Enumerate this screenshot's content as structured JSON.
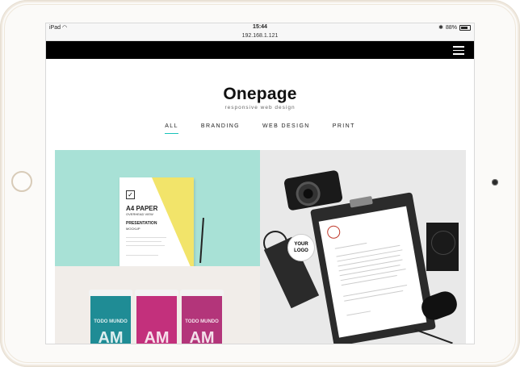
{
  "device": {
    "status_left": "iPad",
    "wifi_glyph": "◠",
    "time": "15:44",
    "bluetooth_glyph": "✱",
    "battery_percent": "88%",
    "url": "192.168.1.121"
  },
  "site": {
    "brand_name": "Onepage",
    "brand_tagline": "responsive web design",
    "accent_color": "#19c3ba"
  },
  "filters": [
    {
      "label": "ALL",
      "active": true
    },
    {
      "label": "BRANDING",
      "active": false
    },
    {
      "label": "WEB DESIGN",
      "active": false
    },
    {
      "label": "PRINT",
      "active": false
    }
  ],
  "portfolio": {
    "a4": {
      "title": "A4 PAPER",
      "subtitle": "OVERHEAD VIEW",
      "heading": "PRESENTATION",
      "sub2": "MOCKUP"
    },
    "cups": {
      "cup1_text": "AM",
      "cup1_small": "TODO MUNDO",
      "cup2_text": "AM",
      "cup3_text": "AM",
      "cup3_small": "TODO MUNDO"
    },
    "stationery": {
      "logo_text": "YOUR LOGO"
    }
  }
}
